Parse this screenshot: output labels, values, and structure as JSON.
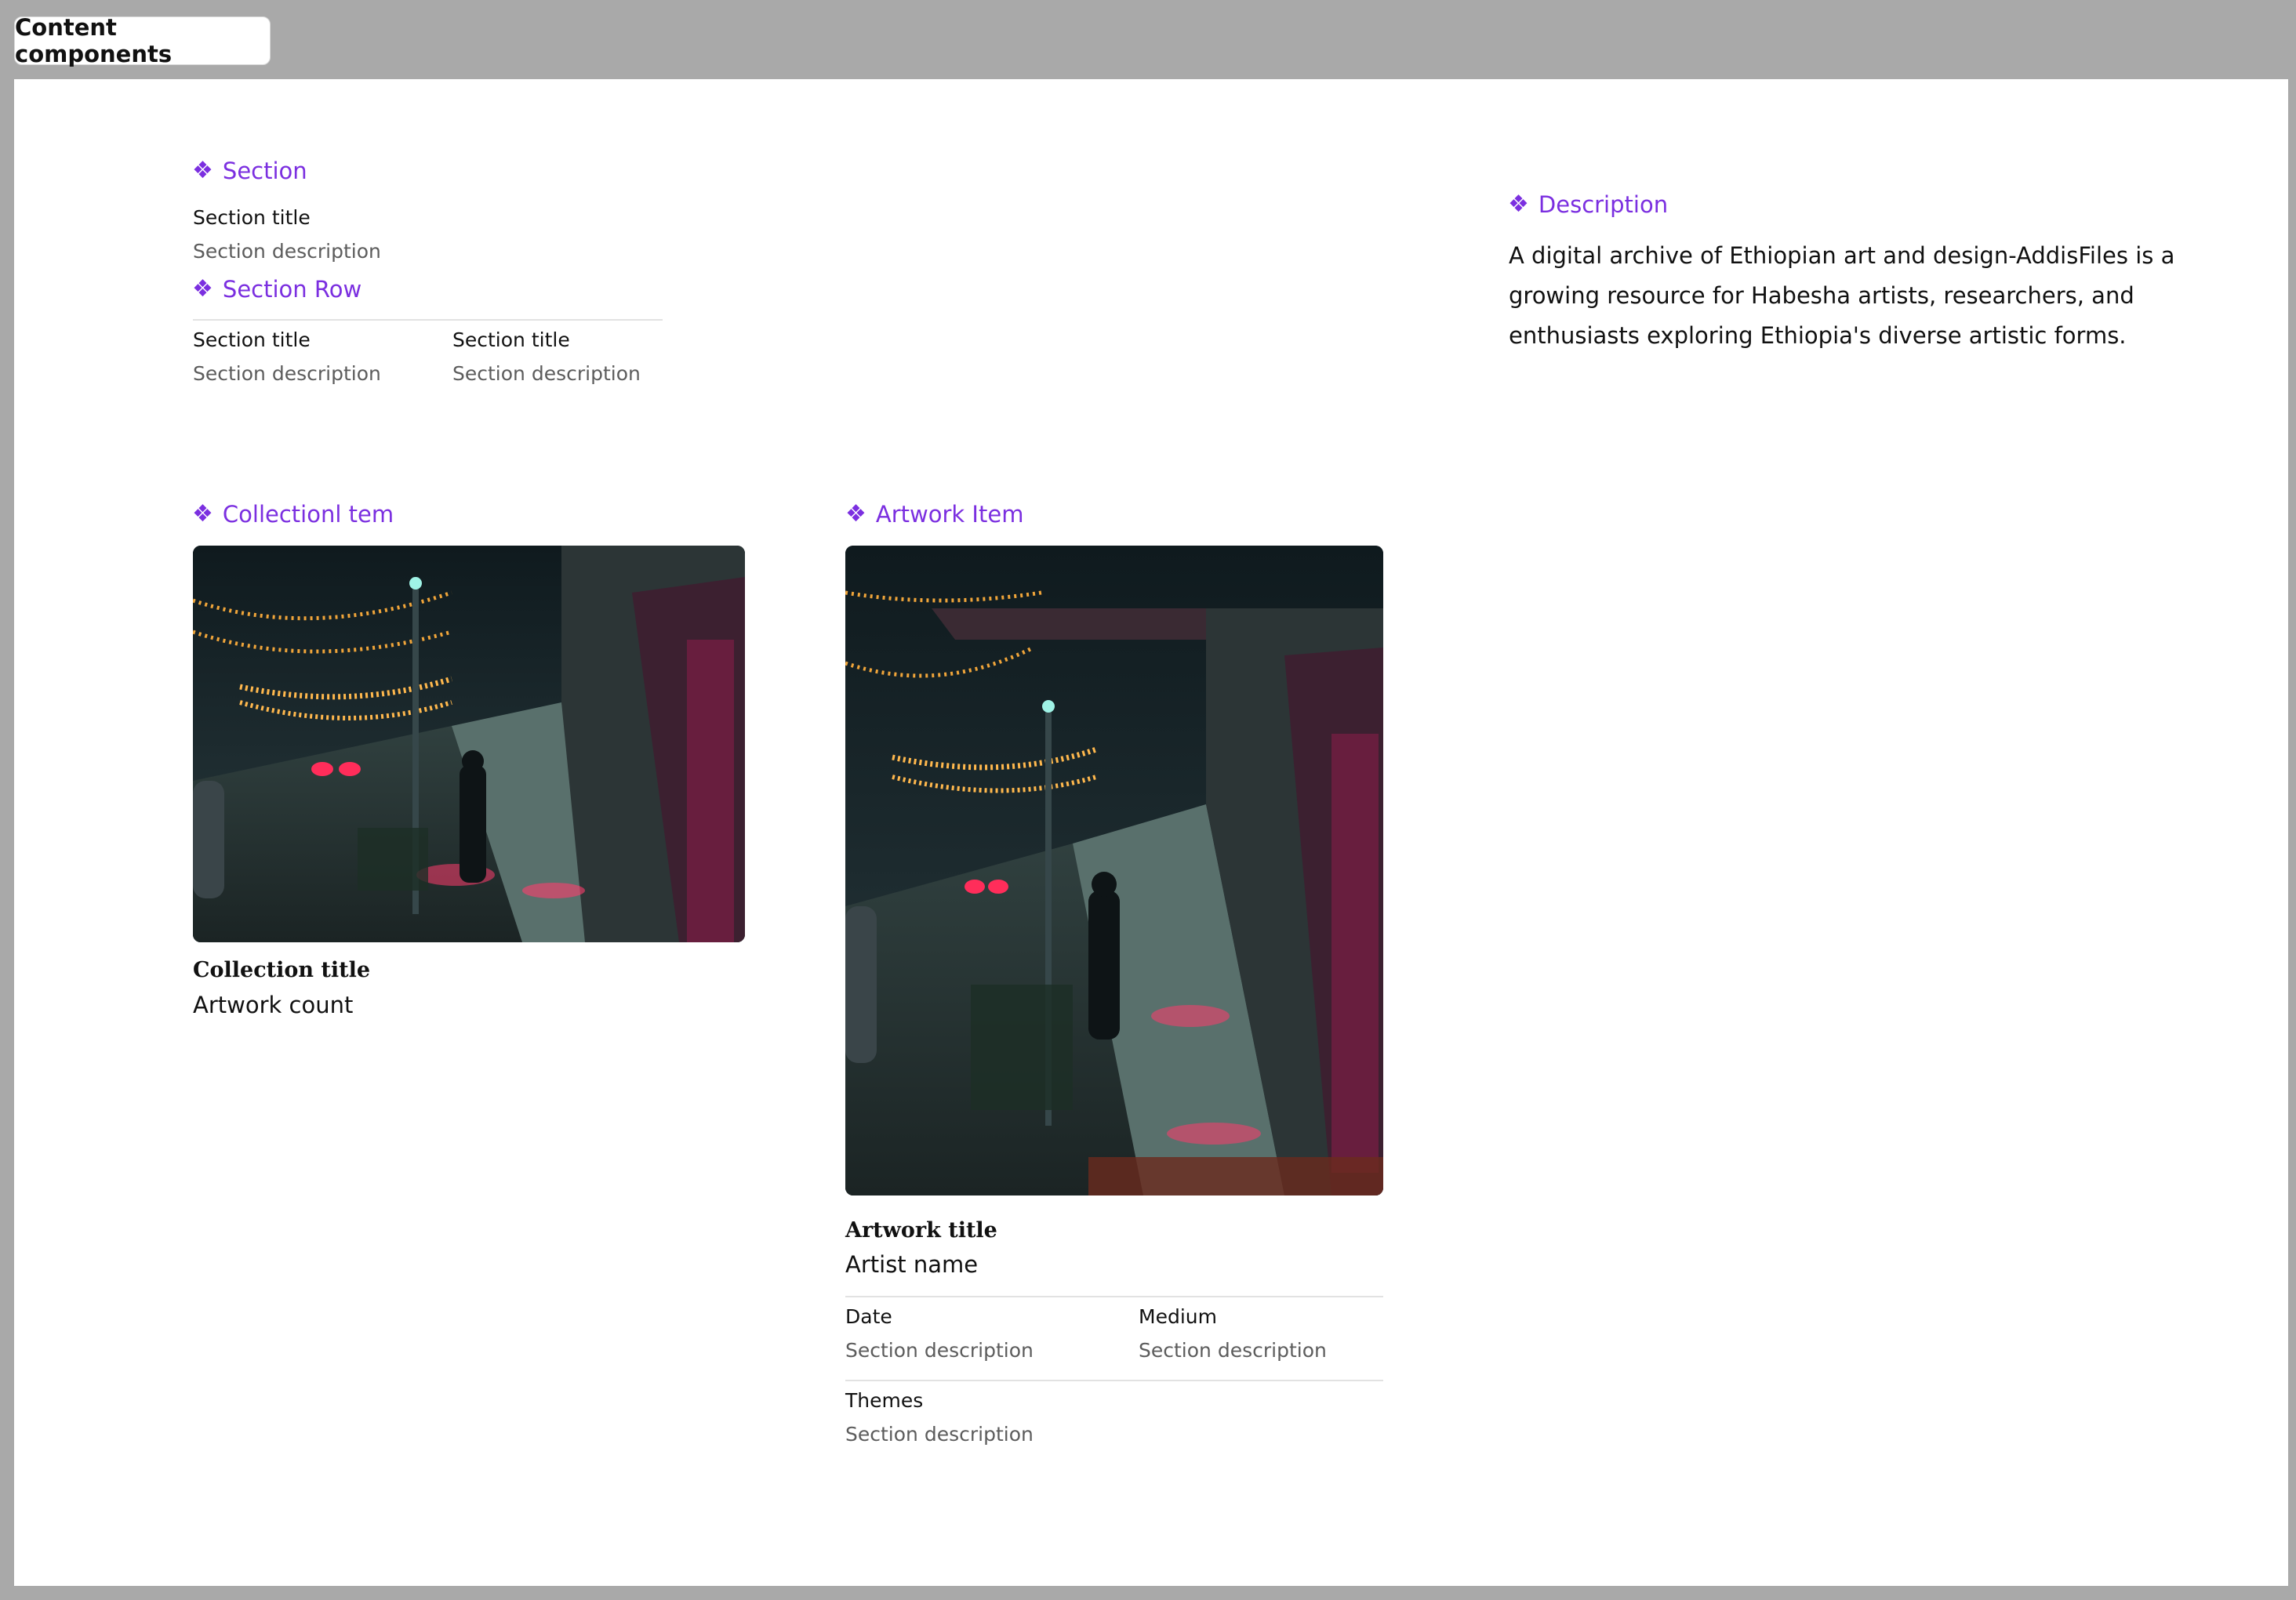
{
  "tab": {
    "label": "Content components"
  },
  "accent_color": "#7b2fe0",
  "components": {
    "section": {
      "label": "Section",
      "icon": "component-diamond-icon",
      "title": "Section title",
      "description": "Section description"
    },
    "section_row": {
      "label": "Section Row",
      "icon": "component-diamond-icon",
      "col1": {
        "title": "Section title",
        "description": "Section description"
      },
      "col2": {
        "title": "Section title",
        "description": "Section description"
      }
    },
    "description": {
      "label": "Description",
      "icon": "component-diamond-icon",
      "text": "A digital archive of Ethiopian art and design-AddisFiles is a growing resource for Habesha artists, researchers, and enthusiasts exploring Ethiopia's diverse artistic forms."
    },
    "collection_item": {
      "label": "Collectionl tem",
      "icon": "component-diamond-icon",
      "image": "night-street-photo",
      "title": "Collection title",
      "count": "Artwork count"
    },
    "artwork_item": {
      "label": "Artwork Item",
      "icon": "component-diamond-icon",
      "image": "night-street-photo",
      "title": "Artwork title",
      "artist": "Artist name",
      "date": {
        "title": "Date",
        "description": "Section description"
      },
      "medium": {
        "title": "Medium",
        "description": "Section description"
      },
      "themes": {
        "title": "Themes",
        "description": "Section description"
      }
    }
  }
}
